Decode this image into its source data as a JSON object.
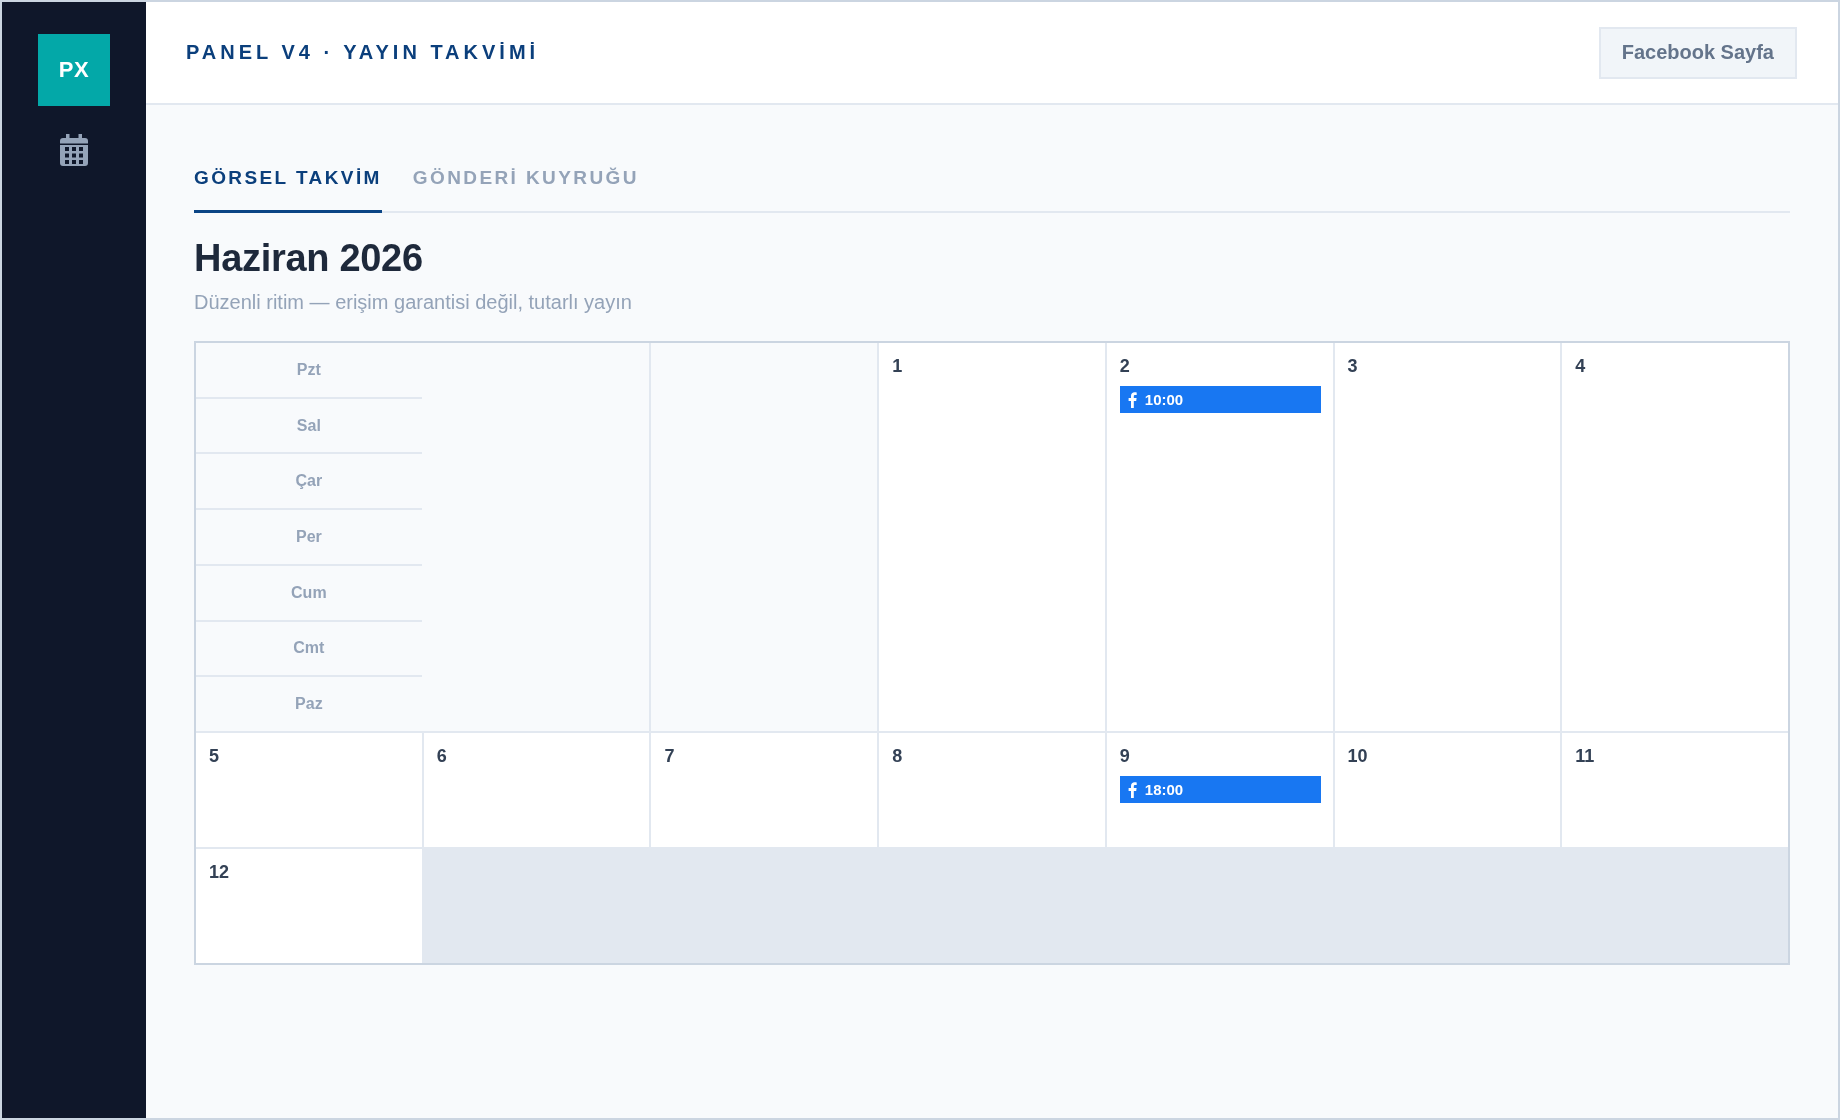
{
  "sidebar": {
    "logo": "PX"
  },
  "header": {
    "title": "PANEL V4 · YAYIN TAKVİMİ",
    "page_button": "Facebook Sayfa"
  },
  "tabs": [
    {
      "label": "GÖRSEL TAKVİM",
      "selected": true
    },
    {
      "label": "GÖNDERİ KUYRUĞU",
      "selected": false
    }
  ],
  "calendar": {
    "title": "Haziran 2026",
    "subtitle": "Düzenli ritim — erişim garantisi değil, tutarlı yayın",
    "cells": [
      {
        "kind": "weekdays",
        "labels": [
          "Pzt",
          "Sal",
          "Çar",
          "Per",
          "Cum",
          "Cmt",
          "Paz"
        ]
      },
      {
        "kind": "blank"
      },
      {
        "kind": "day",
        "day": "1"
      },
      {
        "kind": "day",
        "day": "2",
        "events": [
          {
            "time": "10:00"
          }
        ]
      },
      {
        "kind": "day",
        "day": "3"
      },
      {
        "kind": "day",
        "day": "4"
      },
      {
        "kind": "day",
        "day": "5"
      },
      {
        "kind": "day",
        "day": "6"
      },
      {
        "kind": "day",
        "day": "7"
      },
      {
        "kind": "day",
        "day": "8"
      },
      {
        "kind": "day",
        "day": "9",
        "events": [
          {
            "time": "18:00"
          }
        ]
      },
      {
        "kind": "day",
        "day": "10"
      },
      {
        "kind": "day",
        "day": "11"
      },
      {
        "kind": "day",
        "day": "12"
      }
    ]
  }
}
